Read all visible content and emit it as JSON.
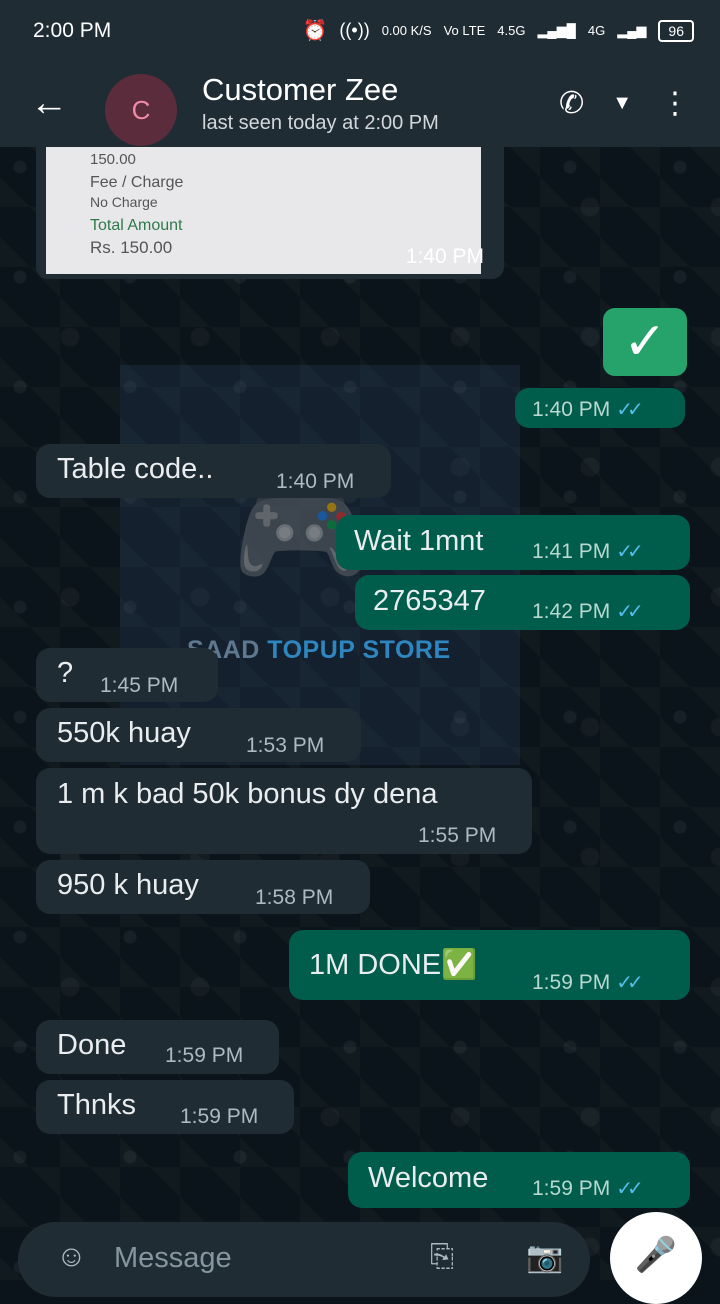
{
  "status_bar": {
    "time": "2:00 PM",
    "net_speed": "0.00 K/S",
    "vo_lte": "Vo LTE",
    "network1": "4.5G",
    "network2": "4G",
    "battery": "96"
  },
  "header": {
    "avatar_letter": "C",
    "contact_name": "Customer Zee",
    "contact_status": "last seen today at 2:00 PM"
  },
  "receipt": {
    "amount_line": "150.00",
    "fee_label": "Fee / Charge",
    "fee_value": "No Charge",
    "total_label": "Total Amount",
    "total_value": "Rs. 150.00",
    "time": "1:40 PM"
  },
  "watermark": {
    "part1": "SAAD",
    "part2": "TOPUP STORE"
  },
  "messages": [
    {
      "text": "",
      "time": "1:40 PM",
      "ticks": "✓✓"
    },
    {
      "text": "Table code..",
      "time": "1:40 PM"
    },
    {
      "text": "Wait 1mnt",
      "time": "1:41 PM",
      "ticks": "✓✓"
    },
    {
      "text": "2765347",
      "time": "1:42 PM",
      "ticks": "✓✓"
    },
    {
      "text": "?",
      "time": "1:45 PM"
    },
    {
      "text": "550k huay",
      "time": "1:53 PM"
    },
    {
      "text": "1 m k bad 50k bonus dy dena",
      "time": "1:55 PM"
    },
    {
      "text": "950 k huay",
      "time": "1:58 PM"
    },
    {
      "text": "1M DONE✅",
      "time": "1:59 PM",
      "ticks": "✓✓"
    },
    {
      "text": "Done",
      "time": "1:59 PM"
    },
    {
      "text": "Thnks",
      "time": "1:59 PM"
    },
    {
      "text": "Welcome",
      "time": "1:59 PM",
      "ticks": "✓✓"
    }
  ],
  "composer": {
    "placeholder": "Message"
  }
}
